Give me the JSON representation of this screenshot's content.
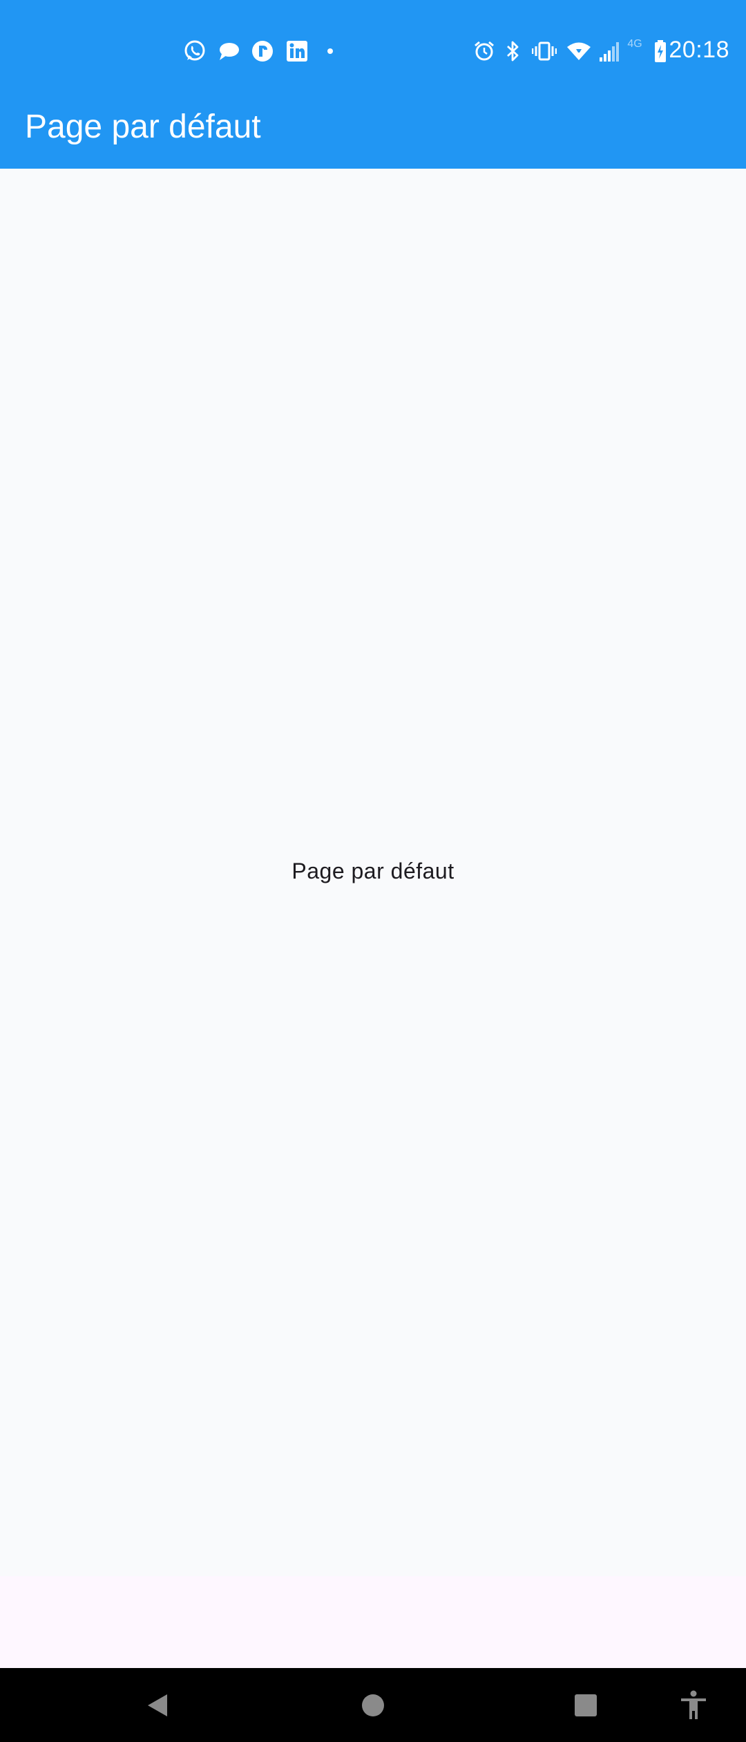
{
  "status_bar": {
    "time": "20:18",
    "network_label": "4G",
    "notification_icons": [
      "whatsapp-icon",
      "chat-bubble-icon",
      "r-app-icon",
      "linkedin-icon",
      "more-dot-icon"
    ],
    "system_icons": [
      "alarm-icon",
      "bluetooth-icon",
      "vibrate-icon",
      "wifi-icon",
      "signal-icon",
      "battery-charging-icon"
    ],
    "background_color": "#2196F3"
  },
  "app_bar": {
    "title": "Page par défaut",
    "background_color": "#2196F3"
  },
  "body": {
    "message": "Page par défaut",
    "background_color": "#F9FAFC"
  },
  "nav_bar": {
    "buttons": [
      "back-icon",
      "home-icon",
      "recents-icon",
      "accessibility-icon"
    ],
    "button_color": "#8A8A8A"
  }
}
